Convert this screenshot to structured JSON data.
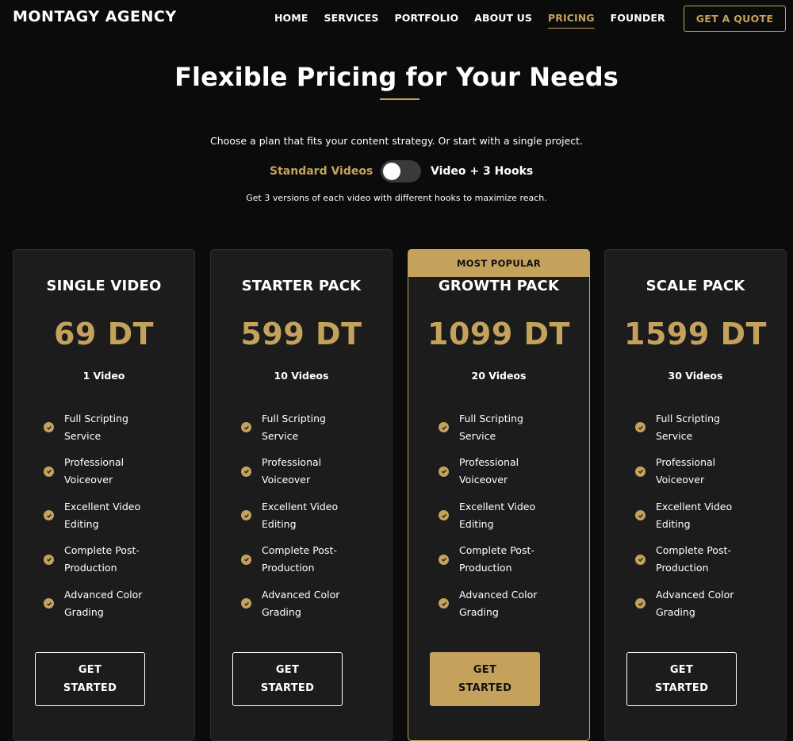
{
  "brand": {
    "name": "MONTAGY AGENCY"
  },
  "nav": {
    "items": [
      {
        "label": "HOME"
      },
      {
        "label": "SERVICES"
      },
      {
        "label": "PORTFOLIO"
      },
      {
        "label": "ABOUT US"
      },
      {
        "label": "PRICING",
        "active": true
      },
      {
        "label": "FOUNDER"
      }
    ],
    "cta": "GET A QUOTE"
  },
  "hero": {
    "title": "Flexible Pricing for Your Needs",
    "subtitle": "Choose a plan that fits your content strategy. Or start with a single project.",
    "toggle_left": "Standard Videos",
    "toggle_right": "Video + 3 Hooks",
    "toggle_on": false,
    "note": "Get 3 versions of each video with different hooks to maximize reach."
  },
  "plans": [
    {
      "name": "SINGLE VIDEO",
      "price": "69 DT",
      "quantity": "1 Video",
      "features": [
        "Full Scripting Service",
        "Professional Voiceover",
        "Excellent Video Editing",
        "Complete Post-Production",
        "Advanced Color Grading"
      ],
      "button": "GET STARTED"
    },
    {
      "name": "STARTER PACK",
      "price": "599 DT",
      "quantity": "10 Videos",
      "features": [
        "Full Scripting Service",
        "Professional Voiceover",
        "Excellent Video Editing",
        "Complete Post-Production",
        "Advanced Color Grading"
      ],
      "button": "GET STARTED"
    },
    {
      "name": "GROWTH PACK",
      "price": "1099 DT",
      "quantity": "20 Videos",
      "badge": "MOST POPULAR",
      "features": [
        "Full Scripting Service",
        "Professional Voiceover",
        "Excellent Video Editing",
        "Complete Post-Production",
        "Advanced Color Grading"
      ],
      "button": "GET STARTED"
    },
    {
      "name": "SCALE PACK",
      "price": "1599 DT",
      "quantity": "30 Videos",
      "features": [
        "Full Scripting Service",
        "Professional Voiceover",
        "Excellent Video Editing",
        "Complete Post-Production",
        "Advanced Color Grading"
      ],
      "button": "GET STARTED"
    }
  ],
  "colors": {
    "accent": "#c5a25c",
    "background": "#0b0b0b",
    "card": "#1c1c1d"
  }
}
